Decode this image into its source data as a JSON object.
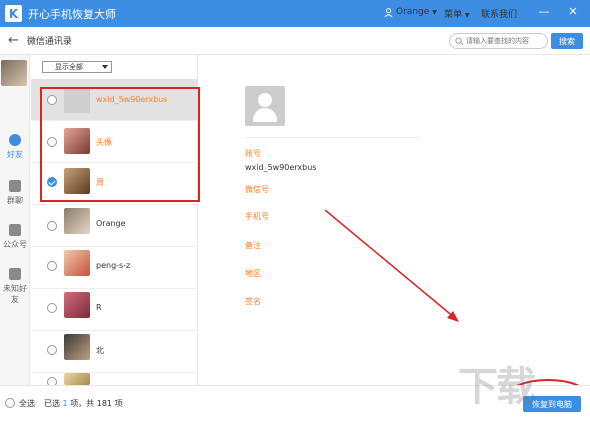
{
  "app": {
    "title": "开心手机恢复大师",
    "logo": "K"
  },
  "topbar": {
    "user": "Orange",
    "menu": "菜单",
    "contact": "联系我们",
    "minimize": "—",
    "close": "✕"
  },
  "subbar": {
    "title": "微信通讯录",
    "search_placeholder": "请输入要查找的内容",
    "search_btn": "搜索"
  },
  "nav": [
    {
      "label": "好友",
      "icon": "person-icon",
      "active": true
    },
    {
      "label": "群聊",
      "icon": "group-icon"
    },
    {
      "label": "公众号",
      "icon": "grid-icon"
    },
    {
      "label": "未知好友",
      "icon": "unknown-person-icon"
    }
  ],
  "filter": {
    "label": "显示全部"
  },
  "contacts": [
    {
      "name": "wxid_5w90erxbus",
      "checked": false,
      "selected": true,
      "highlight": true
    },
    {
      "name": "头像",
      "checked": false,
      "highlight": true
    },
    {
      "name": "周",
      "checked": true,
      "highlight": true
    },
    {
      "name": "Orange",
      "checked": false
    },
    {
      "name": "peng-s-z",
      "checked": false
    },
    {
      "name": "R",
      "checked": false
    },
    {
      "name": "北",
      "checked": false
    },
    {
      "name": "",
      "checked": false
    }
  ],
  "detail": {
    "account_label": "账号",
    "account_value": "wxid_5w90erxbus",
    "wechat_label": "微信号",
    "phone_label": "手机号",
    "note_label": "备注",
    "region_label": "地区",
    "signature_label": "签名"
  },
  "footer": {
    "select_all": "全选",
    "count_prefix": "已选",
    "selected_count": "1",
    "count_mid": "项，共",
    "total_count": "181",
    "count_suffix": "项",
    "recover_btn": "恢复到电脑"
  },
  "colors": {
    "accent": "#3d8ee2",
    "orange": "#ff7f2a",
    "annotation_red": "#d9242a"
  }
}
